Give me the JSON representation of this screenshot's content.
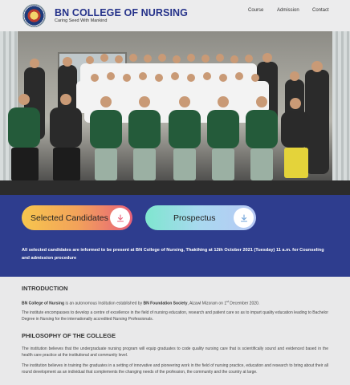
{
  "header": {
    "title": "BN COLLEGE OF NURSING",
    "tagline": "Caring Seed With Mankind",
    "nav": [
      "Course",
      "Admission",
      "Contact"
    ]
  },
  "hero": {
    "image_kind": "group-photo"
  },
  "cta": {
    "selected_label": "Selected Candidates",
    "prospectus_label": "Prospectus",
    "download_icon": "download-icon",
    "notice": "All selected candidates are informed to be present at BN College of Nursing, Thakthing at 12th October 2021 (Tuesday) 11 a.m. for Counseling and admission procedure"
  },
  "intro": {
    "heading": "INTRODUCTION",
    "p1_name": "BN College of Nursing",
    "p1_mid": " is an autonomous Institution established by ",
    "p1_org": "BN Foundation Society",
    "p1_end": ", Aizawl Mizoram on 1",
    "p1_sup": "st",
    "p1_date": " December 2020.",
    "p2": "The institute encompasses to develop a centre of excellence in the field of nursing education, research and patient care so as to impart quality education leading to Bachelor Degree in Nursing for the internationally accredited Nursing Professionals."
  },
  "philosophy": {
    "heading": "PHILOSOPHY OF THE COLLEGE",
    "p1": "The institution believes that the undergraduate nursing program will equip graduates to code quality nursing care that is scientifically sound and evidenced based in the health care practice at the institutional and community level.",
    "p2": "The institution believes in training the graduates in a setting of innovative and pioneering work in the field of nursing practice, education and research to bring about their all round development as an individual that complements the changing needs of the profession, the community and the country at large."
  },
  "colors": {
    "brand_blue": "#25328a",
    "band_blue": "#2e3d8e",
    "selected_gradient": [
      "#f7c64e",
      "#e8627a"
    ],
    "prospectus_gradient": [
      "#7fe6cf",
      "#b8c9f5"
    ]
  }
}
